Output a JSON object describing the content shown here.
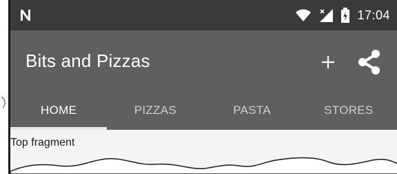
{
  "status_bar": {
    "time": "17:04",
    "icons": [
      "notification-n-icon",
      "wifi-icon",
      "cell-signal-icon",
      "battery-icon"
    ]
  },
  "app_bar": {
    "title": "Bits and Pizzas",
    "actions": [
      "add-icon",
      "share-icon"
    ]
  },
  "tabs": [
    {
      "label": "HOME",
      "active": true
    },
    {
      "label": "PIZZAS",
      "active": false
    },
    {
      "label": "PASTA",
      "active": false
    },
    {
      "label": "STORES",
      "active": false
    }
  ],
  "content": {
    "fragment_label": "Top fragment"
  },
  "colors": {
    "status_bar": "#3a3a3a",
    "app_bar": "#5f5f5f",
    "tab_indicator": "#e8e8e8",
    "content_bg": "#f4f4f4"
  }
}
